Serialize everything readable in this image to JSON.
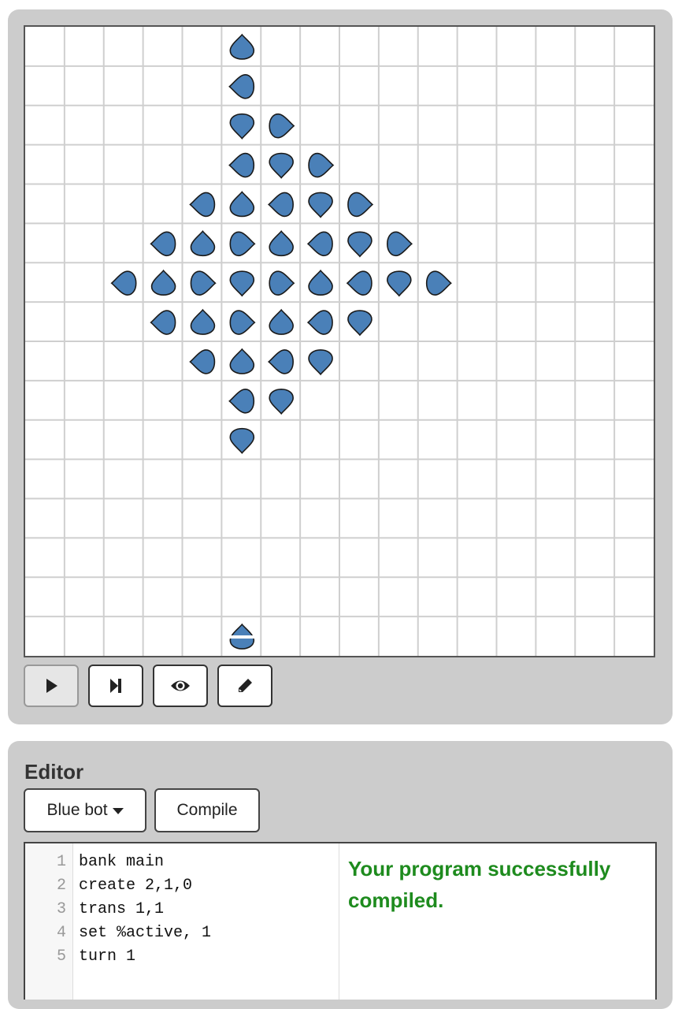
{
  "board": {
    "cols": 16,
    "rows": 16,
    "bot_color": "#4a80b8",
    "bots": [
      {
        "col": 5,
        "row": 0,
        "dir": "up"
      },
      {
        "col": 5,
        "row": 1,
        "dir": "left"
      },
      {
        "col": 5,
        "row": 2,
        "dir": "down"
      },
      {
        "col": 6,
        "row": 2,
        "dir": "right"
      },
      {
        "col": 5,
        "row": 3,
        "dir": "left"
      },
      {
        "col": 6,
        "row": 3,
        "dir": "down"
      },
      {
        "col": 7,
        "row": 3,
        "dir": "right"
      },
      {
        "col": 4,
        "row": 4,
        "dir": "left"
      },
      {
        "col": 5,
        "row": 4,
        "dir": "up"
      },
      {
        "col": 6,
        "row": 4,
        "dir": "left"
      },
      {
        "col": 7,
        "row": 4,
        "dir": "down"
      },
      {
        "col": 8,
        "row": 4,
        "dir": "right"
      },
      {
        "col": 3,
        "row": 5,
        "dir": "left"
      },
      {
        "col": 4,
        "row": 5,
        "dir": "up"
      },
      {
        "col": 5,
        "row": 5,
        "dir": "right"
      },
      {
        "col": 6,
        "row": 5,
        "dir": "up"
      },
      {
        "col": 7,
        "row": 5,
        "dir": "left"
      },
      {
        "col": 8,
        "row": 5,
        "dir": "down"
      },
      {
        "col": 9,
        "row": 5,
        "dir": "right"
      },
      {
        "col": 2,
        "row": 6,
        "dir": "left"
      },
      {
        "col": 3,
        "row": 6,
        "dir": "up"
      },
      {
        "col": 4,
        "row": 6,
        "dir": "right"
      },
      {
        "col": 5,
        "row": 6,
        "dir": "down"
      },
      {
        "col": 6,
        "row": 6,
        "dir": "right"
      },
      {
        "col": 7,
        "row": 6,
        "dir": "up"
      },
      {
        "col": 8,
        "row": 6,
        "dir": "left"
      },
      {
        "col": 9,
        "row": 6,
        "dir": "down"
      },
      {
        "col": 10,
        "row": 6,
        "dir": "right"
      },
      {
        "col": 3,
        "row": 7,
        "dir": "left"
      },
      {
        "col": 4,
        "row": 7,
        "dir": "up"
      },
      {
        "col": 5,
        "row": 7,
        "dir": "right"
      },
      {
        "col": 6,
        "row": 7,
        "dir": "up"
      },
      {
        "col": 7,
        "row": 7,
        "dir": "left"
      },
      {
        "col": 8,
        "row": 7,
        "dir": "down"
      },
      {
        "col": 4,
        "row": 8,
        "dir": "left"
      },
      {
        "col": 5,
        "row": 8,
        "dir": "up"
      },
      {
        "col": 6,
        "row": 8,
        "dir": "left"
      },
      {
        "col": 7,
        "row": 8,
        "dir": "down"
      },
      {
        "col": 5,
        "row": 9,
        "dir": "left"
      },
      {
        "col": 6,
        "row": 9,
        "dir": "down"
      },
      {
        "col": 5,
        "row": 10,
        "dir": "down"
      }
    ],
    "special_bot": {
      "col": 5,
      "row": 15,
      "dir": "up"
    }
  },
  "controls": {
    "play_icon": "play-icon",
    "step_icon": "step-forward-icon",
    "view_icon": "eye-icon",
    "edit_icon": "pencil-icon"
  },
  "editor": {
    "title": "Editor",
    "bot_select_label": "Blue bot",
    "compile_label": "Compile",
    "line_numbers": [
      "1",
      "2",
      "3",
      "4",
      "5"
    ],
    "code_lines": [
      "bank main",
      "create 2,1,0",
      "trans 1,1",
      "set %active, 1",
      "turn 1"
    ],
    "compile_message": "Your program successfully compiled.",
    "message_color": "#1e8b1e"
  }
}
